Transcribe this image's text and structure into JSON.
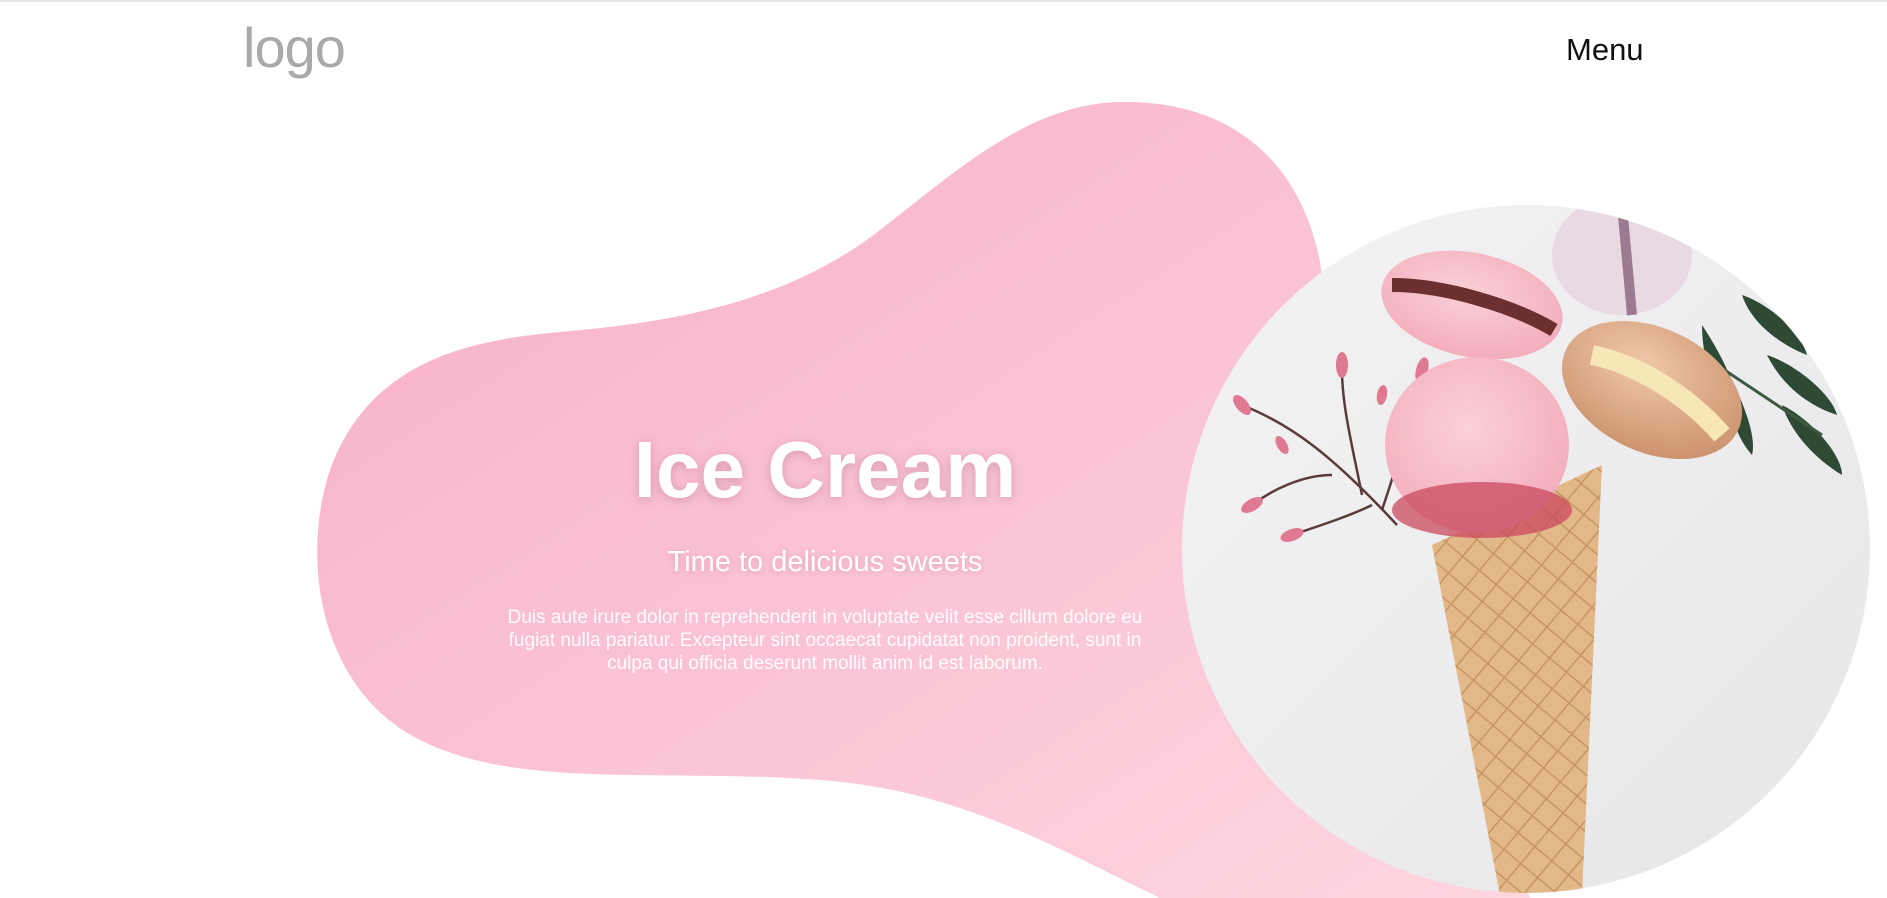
{
  "header": {
    "logo_text": "logo",
    "menu_label": "Menu"
  },
  "hero": {
    "title": "Ice Cream",
    "subtitle": "Time to delicious sweets",
    "body": "Duis aute irure dolor in reprehenderit in voluptate velit esse cillum dolore eu fugiat nulla pariatur. Excepteur sint occaecat cupidatat non proident, sunt in culpa qui officia deserunt mollit anim id est laborum."
  },
  "colors": {
    "blob_start": "#f8b4cb",
    "blob_end": "#fbd0dc",
    "logo": "#a9a9a9",
    "menu_text": "#111111",
    "hero_text": "#ffffff"
  },
  "image": {
    "subject": "ice-cream-cone-with-macarons-photo"
  }
}
